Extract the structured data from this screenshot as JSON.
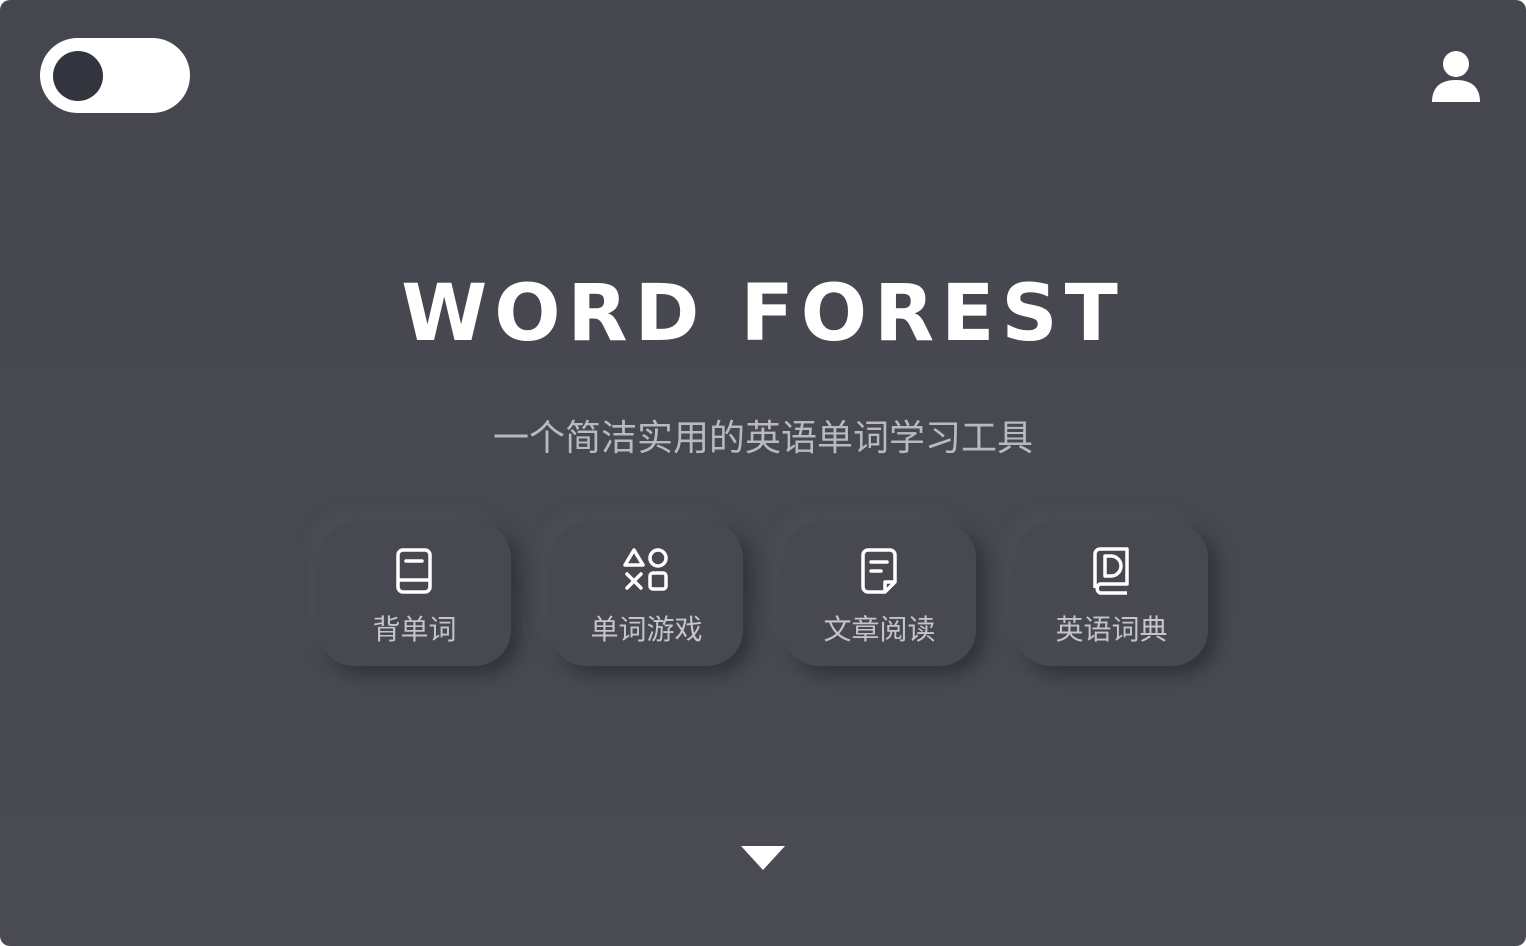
{
  "header": {
    "theme_toggle": {
      "state": "dark-mode",
      "knob_color": "#32353d"
    },
    "user_icon": "user-icon"
  },
  "hero": {
    "title": "WORD FOREST",
    "subtitle": "一个简洁实用的英语单词学习工具"
  },
  "features": [
    {
      "label": "背单词",
      "icon": "book-icon"
    },
    {
      "label": "单词游戏",
      "icon": "game-shapes-icon"
    },
    {
      "label": "文章阅读",
      "icon": "document-icon"
    },
    {
      "label": "英语词典",
      "icon": "dictionary-icon"
    }
  ],
  "scroll_indicator": {
    "icon": "triangle-down-icon"
  },
  "colors": {
    "background": "#47484f",
    "card": "#484850",
    "text_primary": "#ffffff",
    "text_secondary": "#b9bac0",
    "toggle": "#ffffff"
  }
}
